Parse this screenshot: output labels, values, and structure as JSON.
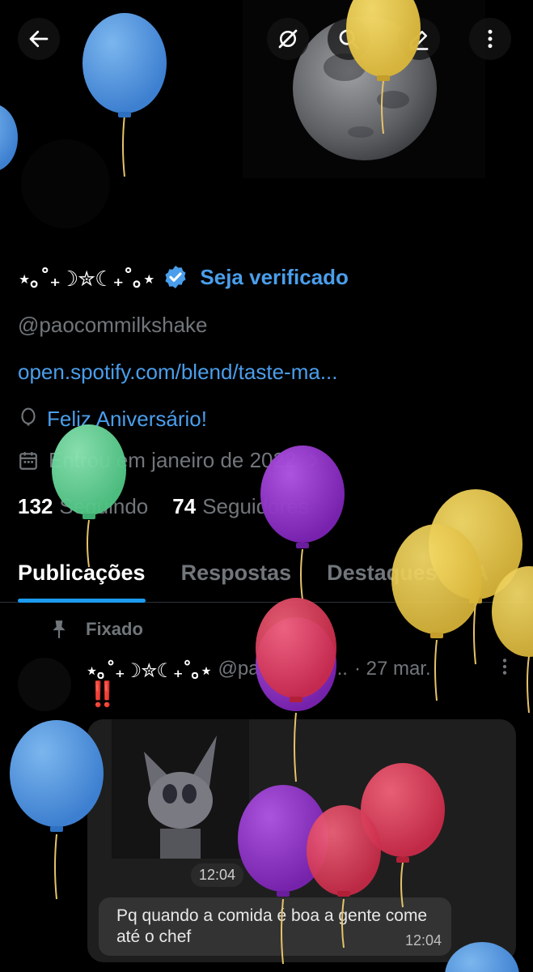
{
  "header": {
    "back_icon": "arrow-left-icon",
    "grok_icon": "grok-icon",
    "search_icon": "search-icon",
    "edit_icon": "edit-icon",
    "more_icon": "more-vertical-icon"
  },
  "profile": {
    "display_name": "⋆｡˚₊☽✮☾₊˚｡⋆",
    "verify_label": "Seja verificado",
    "handle": "@paocommilkshake",
    "link": "open.spotify.com/blend/taste-ma...",
    "birthday": "Feliz Aniversário!",
    "joined": "Entrou em janeiro de 2022",
    "following_count": "132",
    "following_label": "Seguindo",
    "followers_count": "74",
    "followers_label": "Seguidores"
  },
  "tabs": [
    {
      "label": "Publicações"
    },
    {
      "label": "Respostas"
    },
    {
      "label": "Destaques"
    },
    {
      "label": "A"
    }
  ],
  "post": {
    "pinned_label": "Fixado",
    "author": "⋆｡˚₊☽✮☾₊˚｡⋆",
    "handle": "@paocommil...",
    "date": "· 27 mar.",
    "text": "‼️",
    "media_time": "12:04",
    "bubble_text": "Pq quando a comida é boa a gente come até o chef",
    "bubble_time": "12:04"
  },
  "colors": {
    "accent": "#1d9bf0",
    "link": "#4a9eeb",
    "muted": "#71767b"
  }
}
